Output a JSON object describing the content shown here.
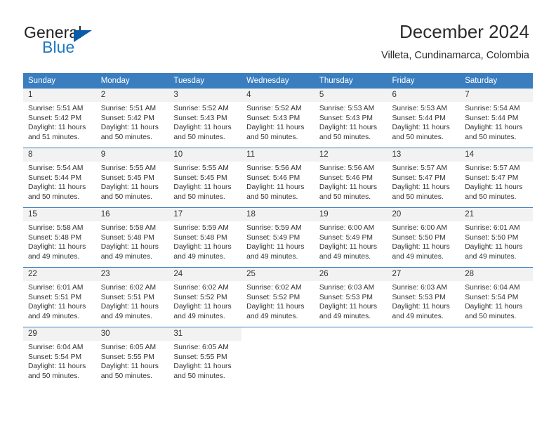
{
  "brand": {
    "word_one": "General",
    "word_two": "Blue",
    "triangle_color": "#0a5ba8",
    "blue_color": "#1f78c1"
  },
  "header": {
    "title": "December 2024",
    "location": "Villeta, Cundinamarca, Colombia"
  },
  "theme": {
    "header_blue": "#3a7ebf",
    "daynum_gray": "#f2f2f2",
    "text": "#333333"
  },
  "weekday_headers": [
    "Sunday",
    "Monday",
    "Tuesday",
    "Wednesday",
    "Thursday",
    "Friday",
    "Saturday"
  ],
  "weeks": [
    [
      {
        "day": "1",
        "sunrise": "Sunrise: 5:51 AM",
        "sunset": "Sunset: 5:42 PM",
        "daylight": "Daylight: 11 hours and 51 minutes."
      },
      {
        "day": "2",
        "sunrise": "Sunrise: 5:51 AM",
        "sunset": "Sunset: 5:42 PM",
        "daylight": "Daylight: 11 hours and 50 minutes."
      },
      {
        "day": "3",
        "sunrise": "Sunrise: 5:52 AM",
        "sunset": "Sunset: 5:43 PM",
        "daylight": "Daylight: 11 hours and 50 minutes."
      },
      {
        "day": "4",
        "sunrise": "Sunrise: 5:52 AM",
        "sunset": "Sunset: 5:43 PM",
        "daylight": "Daylight: 11 hours and 50 minutes."
      },
      {
        "day": "5",
        "sunrise": "Sunrise: 5:53 AM",
        "sunset": "Sunset: 5:43 PM",
        "daylight": "Daylight: 11 hours and 50 minutes."
      },
      {
        "day": "6",
        "sunrise": "Sunrise: 5:53 AM",
        "sunset": "Sunset: 5:44 PM",
        "daylight": "Daylight: 11 hours and 50 minutes."
      },
      {
        "day": "7",
        "sunrise": "Sunrise: 5:54 AM",
        "sunset": "Sunset: 5:44 PM",
        "daylight": "Daylight: 11 hours and 50 minutes."
      }
    ],
    [
      {
        "day": "8",
        "sunrise": "Sunrise: 5:54 AM",
        "sunset": "Sunset: 5:44 PM",
        "daylight": "Daylight: 11 hours and 50 minutes."
      },
      {
        "day": "9",
        "sunrise": "Sunrise: 5:55 AM",
        "sunset": "Sunset: 5:45 PM",
        "daylight": "Daylight: 11 hours and 50 minutes."
      },
      {
        "day": "10",
        "sunrise": "Sunrise: 5:55 AM",
        "sunset": "Sunset: 5:45 PM",
        "daylight": "Daylight: 11 hours and 50 minutes."
      },
      {
        "day": "11",
        "sunrise": "Sunrise: 5:56 AM",
        "sunset": "Sunset: 5:46 PM",
        "daylight": "Daylight: 11 hours and 50 minutes."
      },
      {
        "day": "12",
        "sunrise": "Sunrise: 5:56 AM",
        "sunset": "Sunset: 5:46 PM",
        "daylight": "Daylight: 11 hours and 50 minutes."
      },
      {
        "day": "13",
        "sunrise": "Sunrise: 5:57 AM",
        "sunset": "Sunset: 5:47 PM",
        "daylight": "Daylight: 11 hours and 50 minutes."
      },
      {
        "day": "14",
        "sunrise": "Sunrise: 5:57 AM",
        "sunset": "Sunset: 5:47 PM",
        "daylight": "Daylight: 11 hours and 50 minutes."
      }
    ],
    [
      {
        "day": "15",
        "sunrise": "Sunrise: 5:58 AM",
        "sunset": "Sunset: 5:48 PM",
        "daylight": "Daylight: 11 hours and 49 minutes."
      },
      {
        "day": "16",
        "sunrise": "Sunrise: 5:58 AM",
        "sunset": "Sunset: 5:48 PM",
        "daylight": "Daylight: 11 hours and 49 minutes."
      },
      {
        "day": "17",
        "sunrise": "Sunrise: 5:59 AM",
        "sunset": "Sunset: 5:48 PM",
        "daylight": "Daylight: 11 hours and 49 minutes."
      },
      {
        "day": "18",
        "sunrise": "Sunrise: 5:59 AM",
        "sunset": "Sunset: 5:49 PM",
        "daylight": "Daylight: 11 hours and 49 minutes."
      },
      {
        "day": "19",
        "sunrise": "Sunrise: 6:00 AM",
        "sunset": "Sunset: 5:49 PM",
        "daylight": "Daylight: 11 hours and 49 minutes."
      },
      {
        "day": "20",
        "sunrise": "Sunrise: 6:00 AM",
        "sunset": "Sunset: 5:50 PM",
        "daylight": "Daylight: 11 hours and 49 minutes."
      },
      {
        "day": "21",
        "sunrise": "Sunrise: 6:01 AM",
        "sunset": "Sunset: 5:50 PM",
        "daylight": "Daylight: 11 hours and 49 minutes."
      }
    ],
    [
      {
        "day": "22",
        "sunrise": "Sunrise: 6:01 AM",
        "sunset": "Sunset: 5:51 PM",
        "daylight": "Daylight: 11 hours and 49 minutes."
      },
      {
        "day": "23",
        "sunrise": "Sunrise: 6:02 AM",
        "sunset": "Sunset: 5:51 PM",
        "daylight": "Daylight: 11 hours and 49 minutes."
      },
      {
        "day": "24",
        "sunrise": "Sunrise: 6:02 AM",
        "sunset": "Sunset: 5:52 PM",
        "daylight": "Daylight: 11 hours and 49 minutes."
      },
      {
        "day": "25",
        "sunrise": "Sunrise: 6:02 AM",
        "sunset": "Sunset: 5:52 PM",
        "daylight": "Daylight: 11 hours and 49 minutes."
      },
      {
        "day": "26",
        "sunrise": "Sunrise: 6:03 AM",
        "sunset": "Sunset: 5:53 PM",
        "daylight": "Daylight: 11 hours and 49 minutes."
      },
      {
        "day": "27",
        "sunrise": "Sunrise: 6:03 AM",
        "sunset": "Sunset: 5:53 PM",
        "daylight": "Daylight: 11 hours and 49 minutes."
      },
      {
        "day": "28",
        "sunrise": "Sunrise: 6:04 AM",
        "sunset": "Sunset: 5:54 PM",
        "daylight": "Daylight: 11 hours and 50 minutes."
      }
    ],
    [
      {
        "day": "29",
        "sunrise": "Sunrise: 6:04 AM",
        "sunset": "Sunset: 5:54 PM",
        "daylight": "Daylight: 11 hours and 50 minutes."
      },
      {
        "day": "30",
        "sunrise": "Sunrise: 6:05 AM",
        "sunset": "Sunset: 5:55 PM",
        "daylight": "Daylight: 11 hours and 50 minutes."
      },
      {
        "day": "31",
        "sunrise": "Sunrise: 6:05 AM",
        "sunset": "Sunset: 5:55 PM",
        "daylight": "Daylight: 11 hours and 50 minutes."
      },
      {
        "day": "",
        "sunrise": "",
        "sunset": "",
        "daylight": ""
      },
      {
        "day": "",
        "sunrise": "",
        "sunset": "",
        "daylight": ""
      },
      {
        "day": "",
        "sunrise": "",
        "sunset": "",
        "daylight": ""
      },
      {
        "day": "",
        "sunrise": "",
        "sunset": "",
        "daylight": ""
      }
    ]
  ]
}
